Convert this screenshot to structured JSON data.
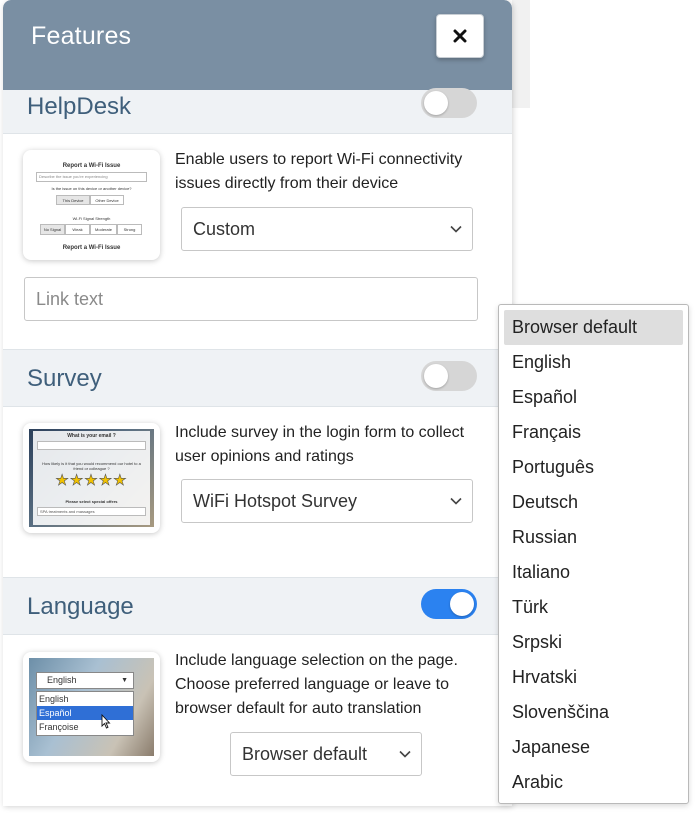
{
  "header": {
    "title": "Features",
    "close_icon": "close-icon"
  },
  "helpdesk": {
    "title": "HelpDesk",
    "enabled": false,
    "description": "Enable users to report Wi-Fi connectivity issues directly from their device",
    "select_value": "Custom",
    "link_placeholder": "Link text",
    "thumb": {
      "title": "Report a Wi-Fi Issue",
      "textbox": "Describe the issue you're experiencing",
      "question": "Is the issue on this device or another device?",
      "device_options": [
        "This Device",
        "Other Device"
      ],
      "signal_label": "Wi-Fi Signal Strength",
      "signal_options": [
        "No Signal",
        "Weak",
        "Moderate",
        "Strong"
      ],
      "footer": "Report a Wi-Fi Issue"
    }
  },
  "survey": {
    "title": "Survey",
    "enabled": false,
    "description": "Include survey in the login form to collect user opinions and ratings",
    "select_value": "WiFi Hotspot Survey",
    "thumb": {
      "q1": "What is your email ?",
      "q2": "How likely is it that you would recommend our hotel to a friend or colleague ?",
      "q3": "Please select special offers",
      "dropdown": "SPA treatments and massages",
      "stars": 5
    }
  },
  "language": {
    "title": "Language",
    "enabled": true,
    "description": "Include language selection on the page. Choose preferred language or leave to browser default for auto translation",
    "select_value": "Browser default",
    "thumb": {
      "select_value": "English",
      "options": [
        "English",
        "Español",
        "Françoise"
      ]
    },
    "dropdown_options": [
      "Browser default",
      "English",
      "Español",
      "Français",
      "Português",
      "Deutsch",
      "Russian",
      "Italiano",
      "Türk",
      "Srpski",
      "Hrvatski",
      "Slovenščina",
      "Japanese",
      "Arabic"
    ]
  },
  "colors": {
    "header": "#7a8fa3",
    "section_title": "#3f5f7b",
    "toggle_on": "#2b82f0",
    "toggle_off": "#d6d6d6"
  }
}
